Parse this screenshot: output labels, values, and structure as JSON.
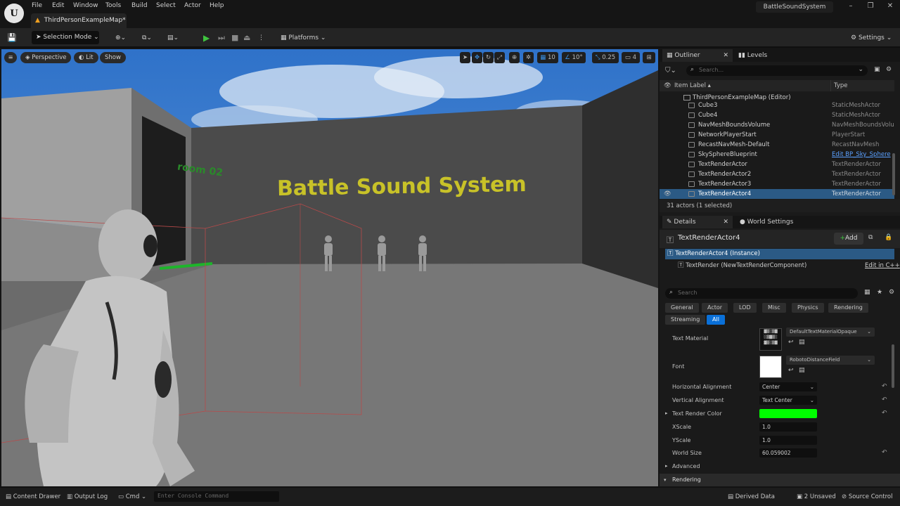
{
  "menu": [
    "File",
    "Edit",
    "Window",
    "Tools",
    "Build",
    "Select",
    "Actor",
    "Help"
  ],
  "project_name": "BattleSoundSystem",
  "level_tab": "ThirdPersonExampleMap*",
  "toolbar": {
    "selection_mode": "Selection Mode",
    "platforms": "Platforms",
    "settings": "Settings"
  },
  "viewport": {
    "perspective": "Perspective",
    "lit": "Lit",
    "show": "Show",
    "grid_snap": "10",
    "rot_snap": "10°",
    "scale_snap": "0.25",
    "camera_speed": "4",
    "scene_title": "Battle Sound System",
    "room_sign": "room 02"
  },
  "outliner": {
    "tab": "Outliner",
    "levels_tab": "Levels",
    "search_placeholder": "Search...",
    "col_label": "Item Label",
    "col_type": "Type",
    "root": "ThirdPersonExampleMap (Editor)",
    "rows": [
      {
        "name": "Cube3",
        "type": "StaticMeshActor"
      },
      {
        "name": "Cube4",
        "type": "StaticMeshActor"
      },
      {
        "name": "NavMeshBoundsVolume",
        "type": "NavMeshBoundsVolu"
      },
      {
        "name": "NetworkPlayerStart",
        "type": "PlayerStart"
      },
      {
        "name": "RecastNavMesh-Default",
        "type": "RecastNavMesh"
      },
      {
        "name": "SkySphereBlueprint",
        "type": "Edit BP_Sky_Sphere"
      },
      {
        "name": "TextRenderActor",
        "type": "TextRenderActor"
      },
      {
        "name": "TextRenderActor2",
        "type": "TextRenderActor"
      },
      {
        "name": "TextRenderActor3",
        "type": "TextRenderActor"
      },
      {
        "name": "TextRenderActor4",
        "type": "TextRenderActor"
      }
    ],
    "summary": "31 actors (1 selected)"
  },
  "details": {
    "tab": "Details",
    "world_tab": "World Settings",
    "actor_name": "TextRenderActor4",
    "add_label": "Add",
    "instance": "TextRenderActor4 (Instance)",
    "component": "TextRender (NewTextRenderComponent)",
    "edit_cpp": "Edit in C++",
    "search_placeholder": "Search",
    "categories": [
      "General",
      "Actor",
      "LOD",
      "Misc",
      "Physics",
      "Rendering",
      "Streaming",
      "All"
    ],
    "text_material_label": "Text Material",
    "text_material_value": "DefaultTextMaterialOpaque",
    "font_label": "Font",
    "font_value": "RobotoDistanceField",
    "props": [
      {
        "label": "Horizontal Alignment",
        "value": "Center"
      },
      {
        "label": "Vertical Alignment",
        "value": "Text Center"
      },
      {
        "label": "Text Render Color",
        "value": ""
      },
      {
        "label": "XScale",
        "value": "1.0"
      },
      {
        "label": "YScale",
        "value": "1.0"
      },
      {
        "label": "World Size",
        "value": "60.059002"
      }
    ],
    "text_render_color": "#00ff00",
    "advanced": "Advanced",
    "rendering": "Rendering"
  },
  "statusbar": {
    "content_drawer": "Content Drawer",
    "output_log": "Output Log",
    "cmd": "Cmd",
    "console_placeholder": "Enter Console Command",
    "derived_data": "Derived Data",
    "unsaved": "2 Unsaved",
    "source_control": "Source Control"
  }
}
